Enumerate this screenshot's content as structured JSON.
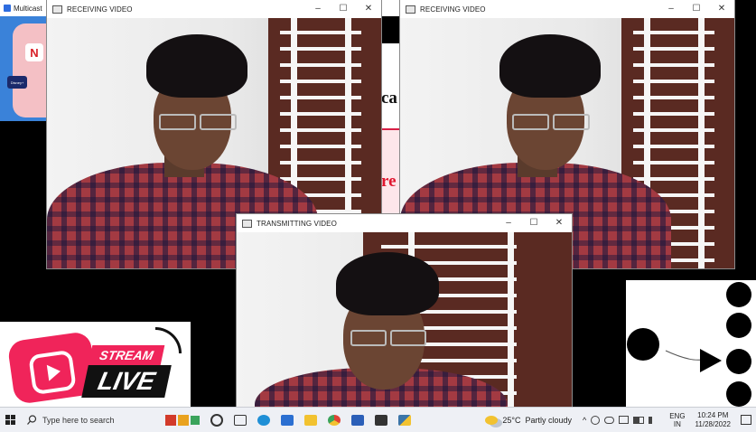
{
  "background_app": {
    "title": "Multicast"
  },
  "background_page": {
    "text_a": "ca",
    "text_b": "re"
  },
  "windows": {
    "receiving_left": {
      "title": "RECEIVING VIDEO"
    },
    "receiving_right": {
      "title": "RECEIVING VIDEO"
    },
    "transmitting": {
      "title": "TRANSMITTING VIDEO"
    }
  },
  "window_controls": {
    "minimize": "–",
    "maximize": "☐",
    "close": "✕"
  },
  "sidebar_promo": {
    "n_logo": "N",
    "disney_label": "Disney+"
  },
  "stream_banner": {
    "stream": "STREAM",
    "live": "LIVE"
  },
  "taskbar": {
    "search_placeholder": "Type here to search",
    "weather_temp": "25°C",
    "weather_desc": "Partly cloudy",
    "lang_top": "ENG",
    "lang_bottom": "IN",
    "time": "10:24 PM",
    "date": "11/28/2022",
    "pinned_icons": [
      "task-view-icon",
      "widgets-icon",
      "edge-icon",
      "mail-icon",
      "file-explorer-icon",
      "chrome-icon",
      "word-icon",
      "terminal-icon",
      "python-icon"
    ],
    "colors": {
      "edge": "#1f8fd6",
      "mail": "#2b6fd1",
      "explorer": "#f2c230",
      "chrome": "#e04335",
      "word": "#2b5fb8",
      "terminal": "#333333",
      "python": "#3b75a8"
    }
  }
}
